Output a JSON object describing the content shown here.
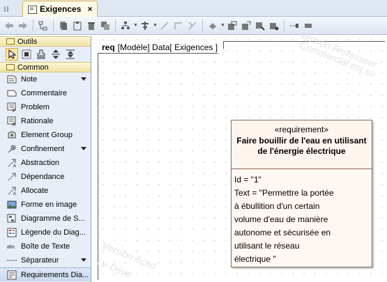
{
  "tab": {
    "title": "Exigences",
    "close": "×"
  },
  "toolbar": {
    "icons": [
      "back-arrow-icon",
      "forward-arrow-icon",
      "tree-icon",
      "copy-icon",
      "paste-icon",
      "delete-icon",
      "layers-icon",
      "layout-icon",
      "align-icon",
      "line-icon",
      "elbow-line-icon",
      "routing-icon",
      "fill-icon",
      "shape-a-icon",
      "shape-b-icon",
      "shape-c-icon",
      "shape-d-icon",
      "more-icon",
      "rect-icon"
    ]
  },
  "palette": {
    "groups": [
      {
        "label": "Outils"
      },
      {
        "label": "Common"
      }
    ],
    "items": [
      {
        "label": "Note",
        "icon": "note-icon",
        "has_dropdown": true
      },
      {
        "label": "Commentaire",
        "icon": "comment-icon",
        "has_dropdown": false
      },
      {
        "label": "Problem",
        "icon": "problem-icon",
        "has_dropdown": false
      },
      {
        "label": "Rationale",
        "icon": "rationale-icon",
        "has_dropdown": false
      },
      {
        "label": "Element Group",
        "icon": "element-group-icon",
        "has_dropdown": false
      },
      {
        "label": "Confinement",
        "icon": "containment-icon",
        "has_dropdown": true
      },
      {
        "label": "Abstraction",
        "icon": "abstraction-icon",
        "has_dropdown": false
      },
      {
        "label": "Dépendance",
        "icon": "dependency-icon",
        "has_dropdown": false
      },
      {
        "label": "Allocate",
        "icon": "allocate-icon",
        "has_dropdown": false
      },
      {
        "label": "Forme en image",
        "icon": "image-shape-icon",
        "has_dropdown": false
      },
      {
        "label": "Diagramme de S...",
        "icon": "diagram-icon",
        "has_dropdown": false
      },
      {
        "label": "Légende du Diag...",
        "icon": "legend-icon",
        "has_dropdown": false
      },
      {
        "label": "Boîte de Texte",
        "icon": "textbox-icon",
        "has_dropdown": false
      },
      {
        "label": "Séparateur",
        "icon": "separator-icon",
        "has_dropdown": true
      }
    ],
    "bottom_item": {
      "label": "Requirements Dia...",
      "icon": "requirements-diagram-icon"
    }
  },
  "diagram": {
    "frame_keyword": "req",
    "frame_label": "[Modèle] Data[ Exigences ]",
    "watermarks": [
      "Version Professeur",
      "Commercial est su",
      "Version Acad",
      "Le Déve"
    ],
    "requirement": {
      "stereotype": "«requirement»",
      "name": "Faire bouillir de l'eau en utilisant de l'énergie électrique",
      "id_line": "Id = \"1\"",
      "text_lines": [
        "Text = \"Permettre la portée",
        "à ébullition d'un certain",
        "volume d'eau de manière",
        "autonome et sécurisée en",
        "utilisant le réseau",
        "électrique \""
      ]
    }
  },
  "colors": {
    "tab_active": "#fffbe8",
    "palette_bg": "#e8eef8",
    "group_header": "#f0e3a6",
    "requirement_fill": "#fff7f2",
    "requirement_border": "#8a6a55"
  }
}
